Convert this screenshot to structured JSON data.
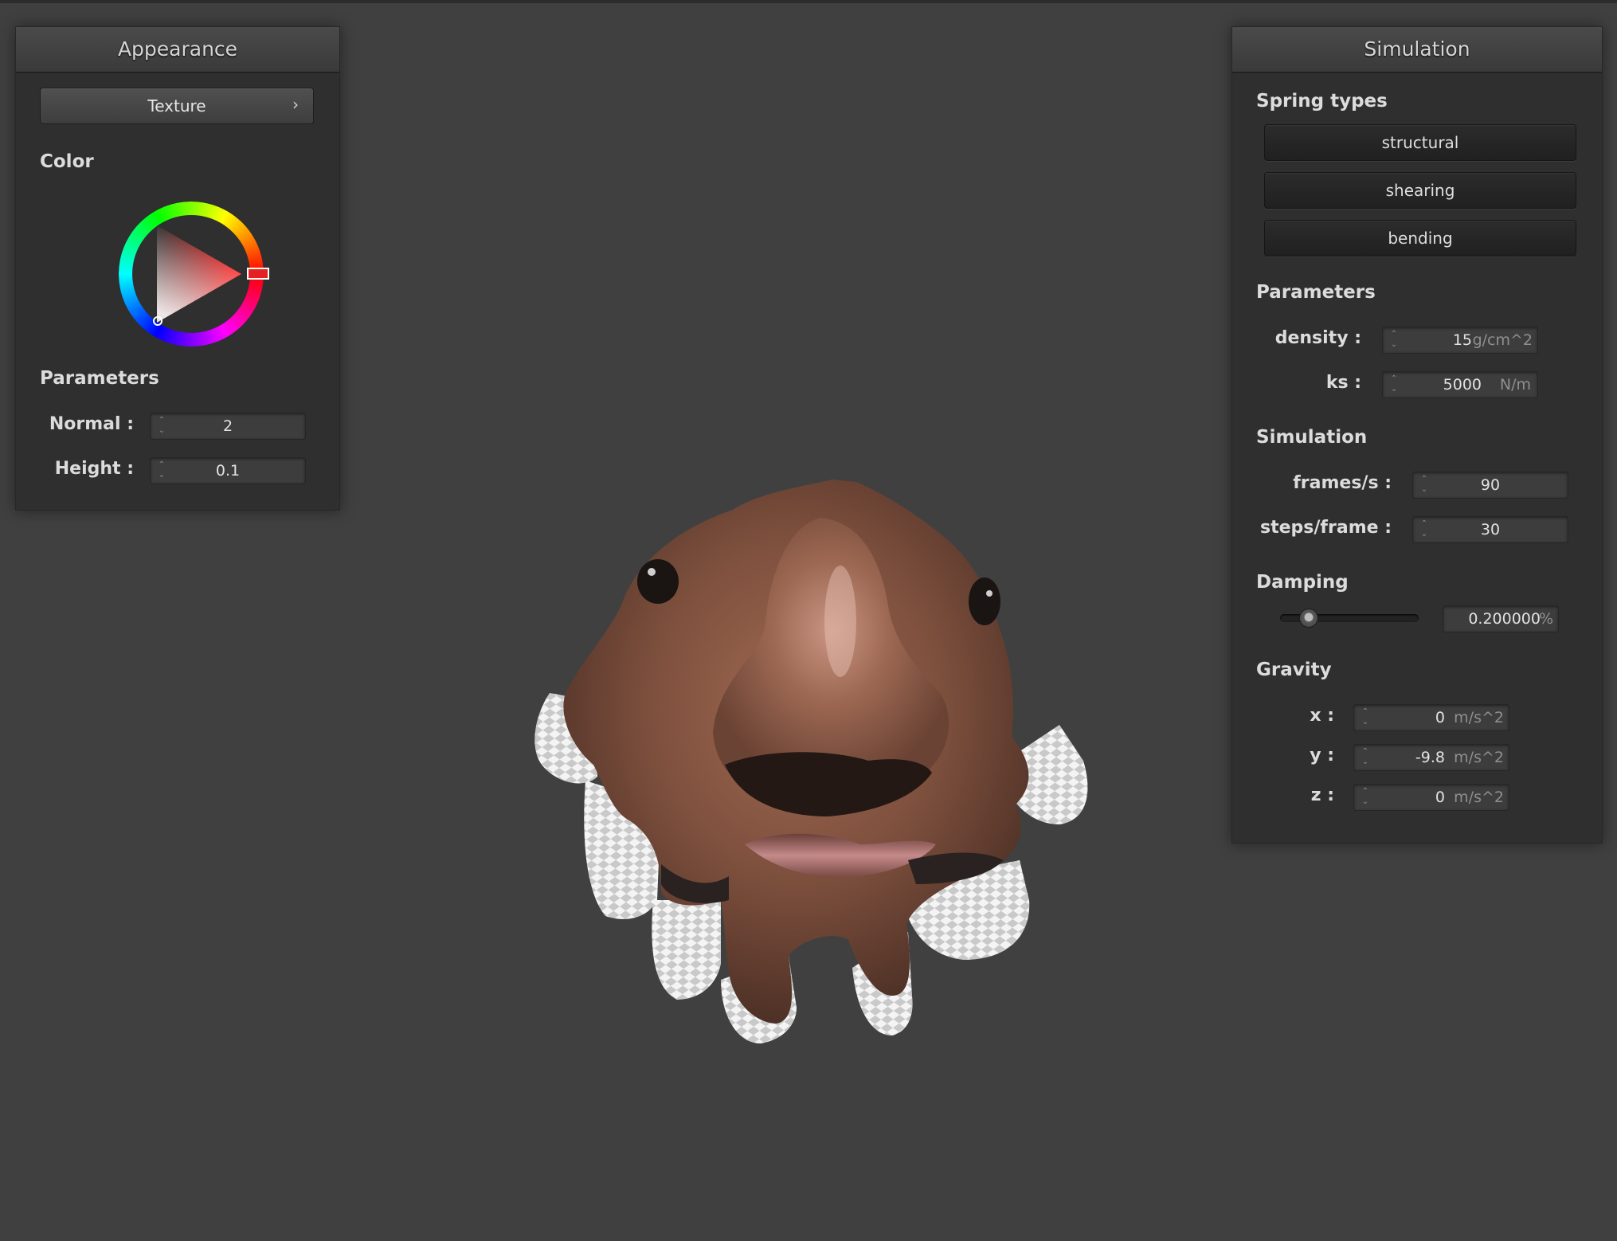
{
  "appearance": {
    "title": "Appearance",
    "texture_button": "Texture",
    "texture_chevron": "›",
    "color_label": "Color",
    "color_value": "#e52222",
    "parameters_label": "Parameters",
    "normal_label": "Normal :",
    "normal_value": "2",
    "height_label": "Height :",
    "height_value": "0.1"
  },
  "simulation": {
    "title": "Simulation",
    "spring_types_label": "Spring types",
    "spring_buttons": [
      "structural",
      "shearing",
      "bending"
    ],
    "parameters_label": "Parameters",
    "density_label": "density :",
    "density_value": "15",
    "density_unit": "g/cm^2",
    "ks_label": "ks :",
    "ks_value": "5000",
    "ks_unit": "N/m",
    "simulation_label": "Simulation",
    "fps_label": "frames/s :",
    "fps_value": "90",
    "steps_label": "steps/frame :",
    "steps_value": "30",
    "damping_label": "Damping",
    "damping_fraction": 0.2,
    "damping_value": "0.200000",
    "damping_unit": "%",
    "gravity_label": "Gravity",
    "gx_label": "x :",
    "gx_value": "0",
    "gy_label": "y :",
    "gy_value": "-9.8",
    "gz_label": "z :",
    "gz_value": "0",
    "gravity_unit": "m/s^2"
  },
  "colors": {
    "background": "#404040",
    "panel": "#2f2f2f",
    "field": "#3d3d3d"
  }
}
